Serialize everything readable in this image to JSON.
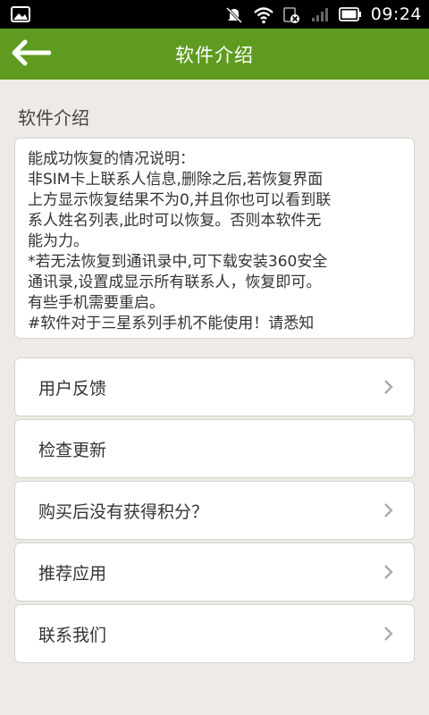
{
  "status_bar": {
    "time": "09:24",
    "icons": [
      "image-notification-icon",
      "mute-icon",
      "wifi-icon",
      "sim-icon",
      "signal-icon",
      "battery-icon"
    ]
  },
  "app_bar": {
    "title": "软件介绍",
    "back_icon": "back-arrow-icon",
    "color": "#5e9b20"
  },
  "section": {
    "title": "软件介绍"
  },
  "info": {
    "lines": [
      "能成功恢复的情况说明：",
      "非SIM卡上联系人信息,删除之后,若恢复界面",
      "上方显示恢复结果不为0,并且你也可以看到联",
      "系人姓名列表,此时可以恢复。否则本软件无",
      "能为力。",
      "*若无法恢复到通讯录中,可下载安装360安全",
      "通讯录,设置成显示所有联系人，恢复即可。",
      "有些手机需要重启。",
      " #软件对于三星系列手机不能使用！请悉知"
    ]
  },
  "menu": {
    "items": [
      {
        "label": "用户反馈",
        "has_chevron": true
      },
      {
        "label": "检查更新",
        "has_chevron": false
      },
      {
        "label": "购买后没有获得积分？",
        "has_chevron": true
      },
      {
        "label": "推荐应用",
        "has_chevron": true
      },
      {
        "label": "联系我们",
        "has_chevron": true
      }
    ]
  }
}
